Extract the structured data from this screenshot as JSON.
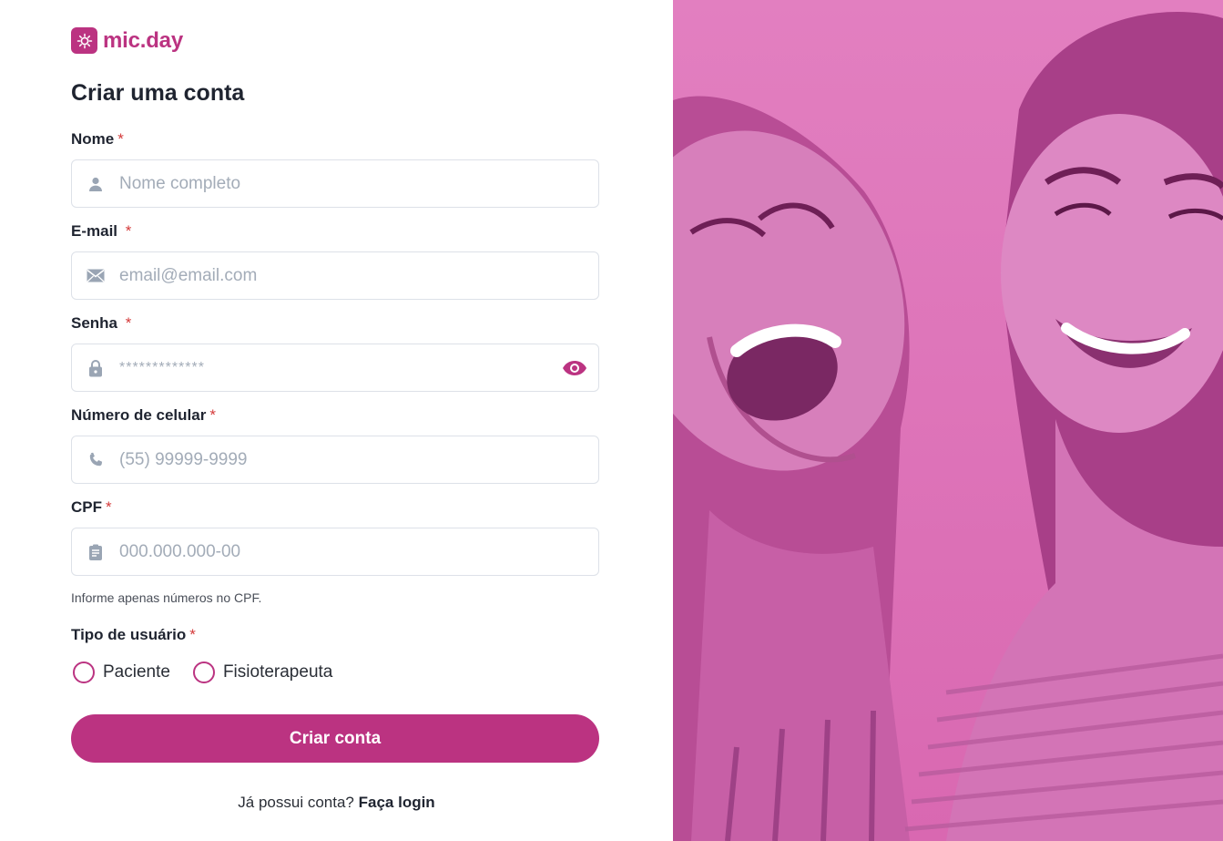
{
  "brand": {
    "name": "mic.day",
    "icon": "sun-logo-icon",
    "color": "#bb3381"
  },
  "title": "Criar uma conta",
  "required_mark": "*",
  "fields": {
    "nome": {
      "label": "Nome",
      "placeholder": "Nome completo",
      "icon": "user-icon"
    },
    "email": {
      "label": "E-mail",
      "placeholder": "email@email.com",
      "icon": "envelope-icon"
    },
    "senha": {
      "label": "Senha",
      "placeholder": "*************",
      "icon": "lock-icon",
      "toggle_icon": "eye-icon"
    },
    "celular": {
      "label": "Número de celular",
      "placeholder": "(55) 99999-9999",
      "icon": "phone-icon"
    },
    "cpf": {
      "label": "CPF",
      "placeholder": "000.000.000-00",
      "icon": "id-card-icon",
      "hint": "Informe apenas números no CPF."
    }
  },
  "user_type": {
    "label": "Tipo de usuário",
    "options": [
      "Paciente",
      "Fisioterapeuta"
    ]
  },
  "submit_label": "Criar conta",
  "footer": {
    "text": "Já possui conta?",
    "link": "Faça login"
  },
  "colors": {
    "accent": "#bb3381",
    "required": "#d43a3a",
    "hero_overlay": "#dd72b8"
  }
}
